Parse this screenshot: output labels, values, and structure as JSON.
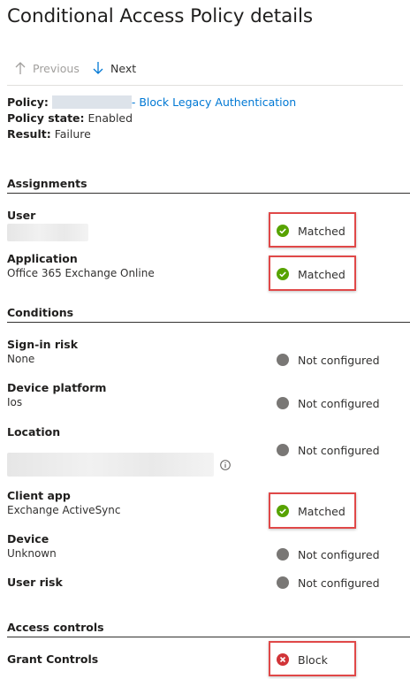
{
  "page": {
    "title": "Conditional Access Policy details"
  },
  "nav": {
    "previous_label": "Previous",
    "next_label": "Next"
  },
  "summary": {
    "policy_label": "Policy:",
    "policy_name": "- Block Legacy Authentication",
    "state_label": "Policy state:",
    "state_value": "Enabled",
    "result_label": "Result:",
    "result_value": "Failure"
  },
  "assignments": {
    "heading": "Assignments",
    "rows": [
      {
        "label": "User",
        "value": "",
        "status": "Matched"
      },
      {
        "label": "Application",
        "value": "Office 365 Exchange Online",
        "status": "Matched"
      }
    ]
  },
  "conditions": {
    "heading": "Conditions",
    "rows": [
      {
        "label": "Sign-in risk",
        "value": "None",
        "status": "Not configured"
      },
      {
        "label": "Device platform",
        "value": "Ios",
        "status": "Not configured"
      },
      {
        "label": "Location",
        "value": "",
        "status": "Not configured"
      },
      {
        "label": "Client app",
        "value": "Exchange ActiveSync",
        "status": "Matched"
      },
      {
        "label": "Device",
        "value": "Unknown",
        "status": "Not configured"
      },
      {
        "label": "User risk",
        "value": "",
        "status": "Not configured"
      }
    ]
  },
  "access_controls": {
    "heading": "Access controls",
    "rows": [
      {
        "label": "Grant Controls",
        "status": "Block"
      }
    ]
  },
  "colors": {
    "matched": "#57a300",
    "not_configured": "#797775",
    "block": "#d13438",
    "link": "#0078d4",
    "highlight": "#e04848"
  },
  "icons": {
    "matched": "check-circle-icon",
    "not_configured": "gray-dot-icon",
    "block": "error-circle-icon",
    "info": "info-icon",
    "previous": "arrow-up-icon",
    "next": "arrow-down-icon"
  }
}
